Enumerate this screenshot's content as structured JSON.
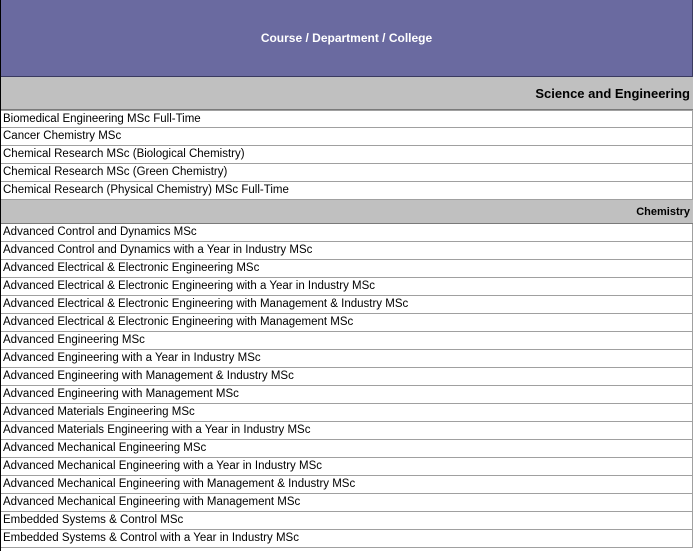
{
  "header": {
    "title": "Course / Department / College"
  },
  "colors": {
    "header_bg": "#6a6aa0",
    "section_bg": "#c0c0c0"
  },
  "sections": [
    {
      "heading": "Science and Engineering",
      "rows": []
    },
    {
      "heading": "",
      "rows": [
        "Biomedical Engineering MSc Full-Time",
        "Cancer Chemistry MSc",
        "Chemical Research MSc (Biological Chemistry)",
        "Chemical Research MSc (Green Chemistry)",
        "Chemical Research (Physical Chemistry) MSc Full-Time"
      ]
    },
    {
      "heading": "Chemistry",
      "rows": [
        "Advanced Control and Dynamics MSc",
        "Advanced Control and Dynamics with a Year in Industry MSc",
        "Advanced Electrical & Electronic Engineering MSc",
        "Advanced Electrical & Electronic Engineering with a Year in Industry MSc",
        "Advanced Electrical & Electronic Engineering with Management & Industry MSc",
        "Advanced Electrical & Electronic Engineering with Management MSc",
        "Advanced Engineering MSc",
        "Advanced Engineering with a Year in Industry MSc",
        "Advanced Engineering with Management & Industry MSc",
        "Advanced Engineering with Management MSc",
        "Advanced Materials Engineering MSc",
        "Advanced Materials Engineering with a Year in Industry MSc",
        "Advanced Mechanical Engineering MSc",
        "Advanced Mechanical Engineering with a Year in Industry MSc",
        "Advanced Mechanical Engineering with Management & Industry MSc",
        "Advanced Mechanical Engineering with Management MSc",
        "Embedded Systems & Control MSc",
        "Embedded Systems & Control with a Year in Industry MSc"
      ]
    }
  ]
}
